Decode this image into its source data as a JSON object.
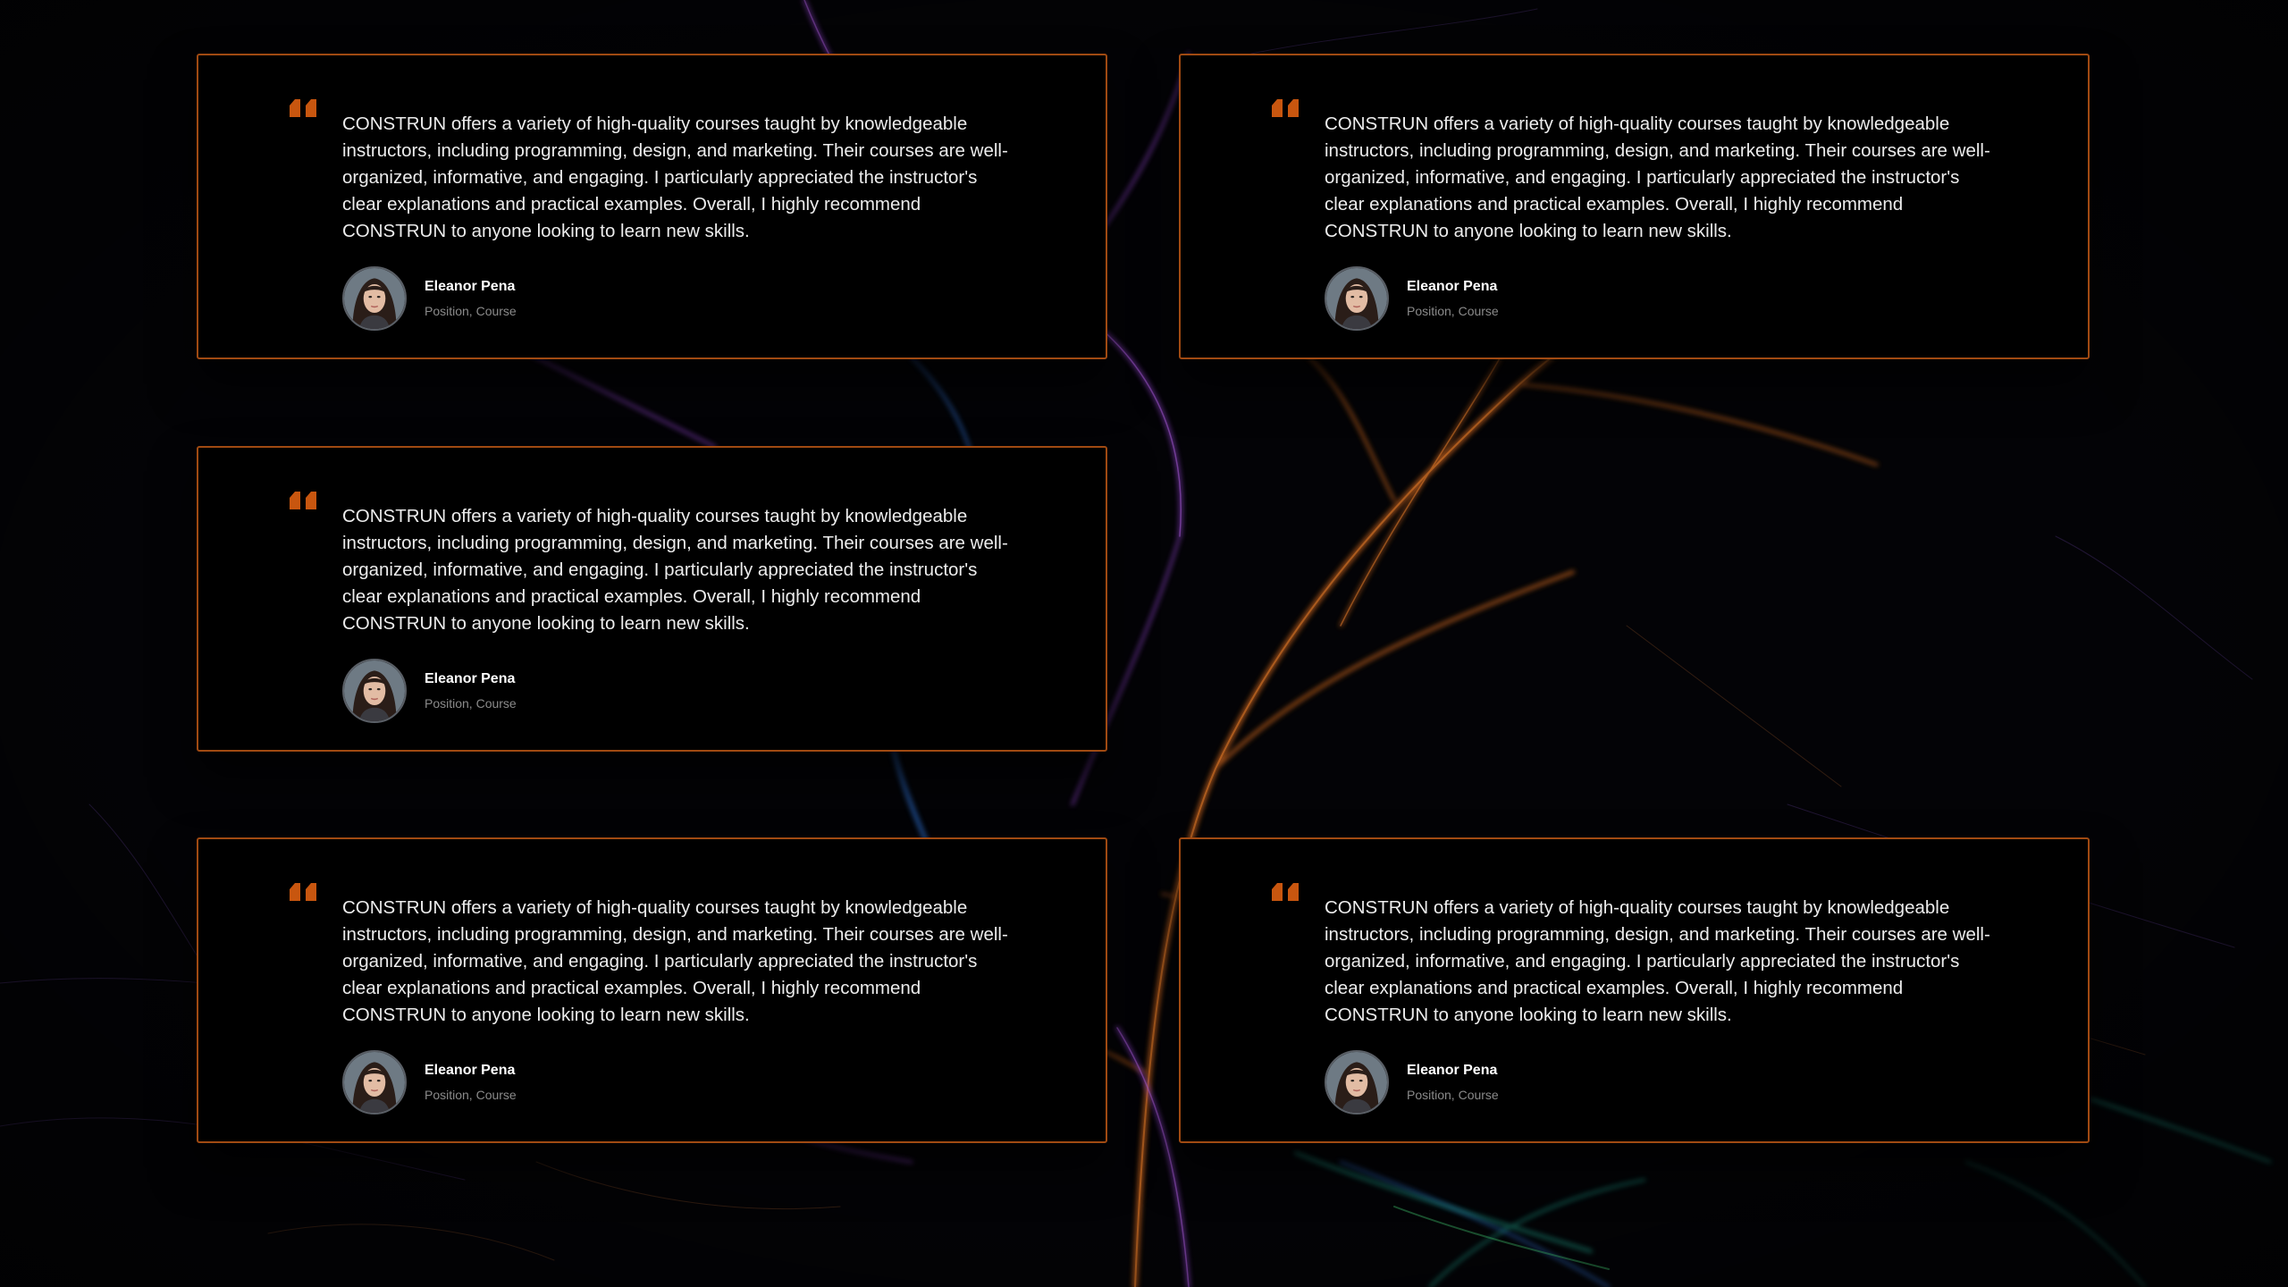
{
  "theme": {
    "accent": "#c8560f",
    "card_border": "#a04a12",
    "card_background": "#000000",
    "text_color": "#ececec",
    "muted_text_color": "#8a8a8a"
  },
  "testimonials": [
    {
      "quote_icon": "quote-icon",
      "text": "CONSTRUN offers a variety of high-quality courses taught by knowledgeable instructors, including programming, design, and marketing. Their courses are well-organized, informative, and engaging. I particularly appreciated the instructor's clear explanations and practical examples. Overall, I highly recommend CONSTRUN to anyone looking to learn new skills.",
      "avatar": "avatar-photo",
      "name": "Eleanor Pena",
      "role": "Position, Course"
    },
    {
      "quote_icon": "quote-icon",
      "text": "CONSTRUN offers a variety of high-quality courses taught by knowledgeable instructors, including programming, design, and marketing. Their courses are well-organized, informative, and engaging. I particularly appreciated the instructor's clear explanations and practical examples. Overall, I highly recommend CONSTRUN to anyone looking to learn new skills.",
      "avatar": "avatar-photo",
      "name": "Eleanor Pena",
      "role": "Position, Course"
    },
    {
      "quote_icon": "quote-icon",
      "text": "CONSTRUN offers a variety of high-quality courses taught by knowledgeable instructors, including programming, design, and marketing. Their courses are well-organized, informative, and engaging. I particularly appreciated the instructor's clear explanations and practical examples. Overall, I highly recommend CONSTRUN to anyone looking to learn new skills.",
      "avatar": "avatar-photo",
      "name": "Eleanor Pena",
      "role": "Position, Course"
    },
    {
      "quote_icon": "quote-icon",
      "text": "CONSTRUN offers a variety of high-quality courses taught by knowledgeable instructors, including programming, design, and marketing. Their courses are well-organized, informative, and engaging. I particularly appreciated the instructor's clear explanations and practical examples. Overall, I highly recommend CONSTRUN to anyone looking to learn new skills.",
      "avatar": "avatar-photo",
      "name": "Eleanor Pena",
      "role": "Position, Course"
    },
    {
      "quote_icon": "quote-icon",
      "text": "CONSTRUN offers a variety of high-quality courses taught by knowledgeable instructors, including programming, design, and marketing. Their courses are well-organized, informative, and engaging. I particularly appreciated the instructor's clear explanations and practical examples. Overall, I highly recommend CONSTRUN to anyone looking to learn new skills.",
      "avatar": "avatar-photo",
      "name": "Eleanor Pena",
      "role": "Position, Course"
    }
  ]
}
